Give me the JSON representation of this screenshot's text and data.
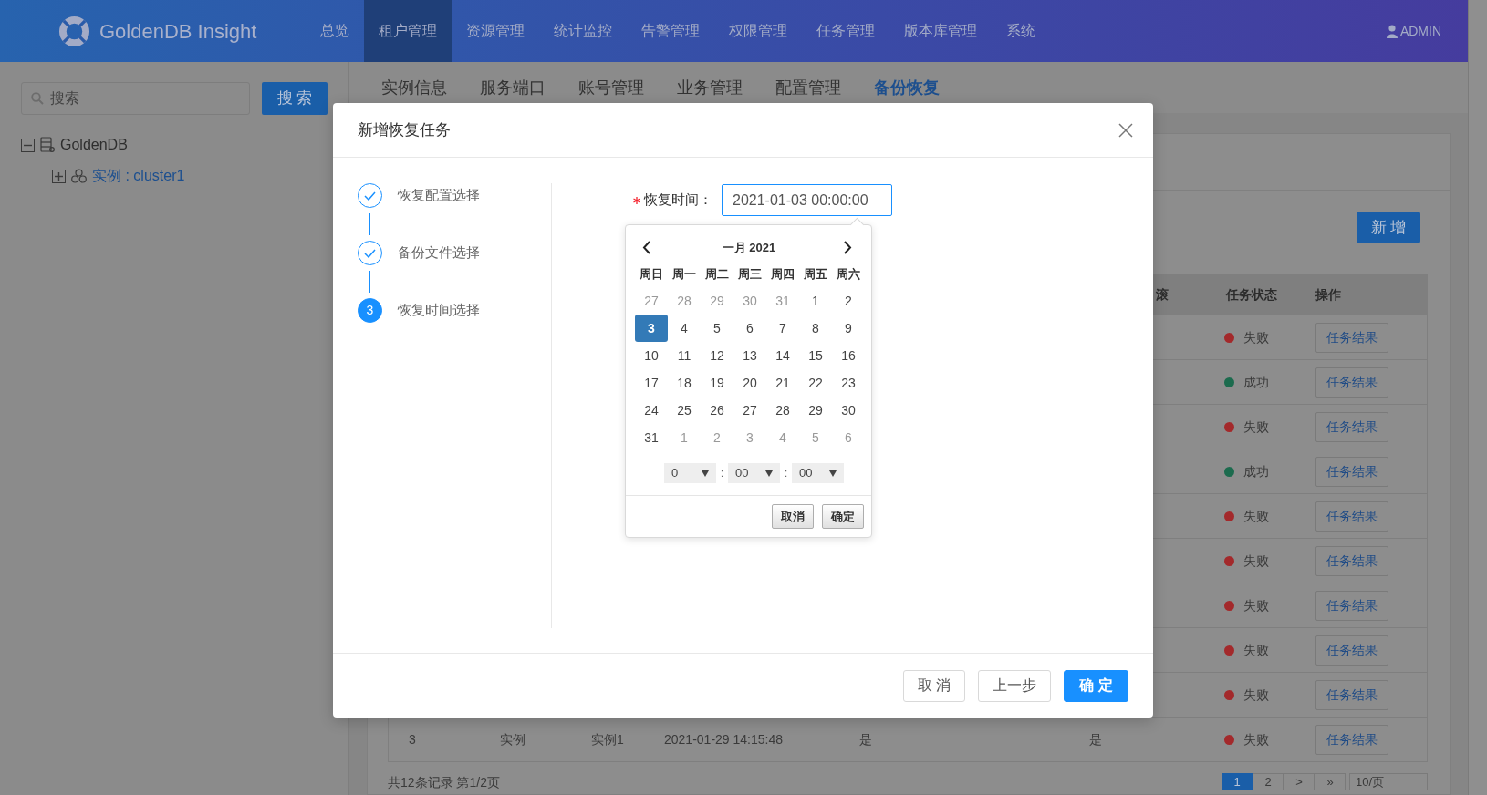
{
  "header": {
    "logo_text": "GoldenDB Insight",
    "nav": [
      {
        "label": "总览",
        "selected": false
      },
      {
        "label": "租户管理",
        "selected": true
      },
      {
        "label": "资源管理",
        "selected": false
      },
      {
        "label": "统计监控",
        "selected": false
      },
      {
        "label": "告警管理",
        "selected": false
      },
      {
        "label": "权限管理",
        "selected": false
      },
      {
        "label": "任务管理",
        "selected": false
      },
      {
        "label": "版本库管理",
        "selected": false
      },
      {
        "label": "系统",
        "selected": false
      }
    ],
    "user": "ADMIN"
  },
  "sidebar": {
    "search": {
      "placeholder": "搜索"
    },
    "search_button": "搜 索",
    "tree": [
      {
        "label": "GoldenDB",
        "expanded": true,
        "children": [
          {
            "label": "实例 : cluster1",
            "expanded": false
          }
        ]
      }
    ]
  },
  "tabs": [
    {
      "label": "实例信息",
      "selected": false
    },
    {
      "label": "服务端口",
      "selected": false
    },
    {
      "label": "账号管理",
      "selected": false
    },
    {
      "label": "业务管理",
      "selected": false
    },
    {
      "label": "配置管理",
      "selected": false
    },
    {
      "label": "备份恢复",
      "selected": true
    }
  ],
  "toolbar": {
    "add_button": "新 增"
  },
  "table": {
    "columns": [
      "滚",
      "任务状态",
      "操作"
    ],
    "rows": [
      {
        "status": "失败",
        "color": "#a3292b",
        "action": "任务结果"
      },
      {
        "status": "成功",
        "color": "#1c6b4e",
        "action": "任务结果"
      },
      {
        "status": "失败",
        "color": "#a3292b",
        "action": "任务结果"
      },
      {
        "status": "成功",
        "color": "#1c6b4e",
        "action": "任务结果"
      },
      {
        "status": "失败",
        "color": "#a3292b",
        "action": "任务结果"
      },
      {
        "status": "失败",
        "color": "#a3292b",
        "action": "任务结果"
      },
      {
        "status": "失败",
        "color": "#a3292b",
        "action": "任务结果"
      },
      {
        "status": "失败",
        "color": "#a3292b",
        "action": "任务结果"
      },
      {
        "status": "失败",
        "color": "#a3292b",
        "action": "任务结果"
      },
      {
        "cells": [
          "3",
          "实例",
          "实例1",
          "2021-01-29 14:15:48",
          "是",
          "是"
        ],
        "status": "失败",
        "color": "#a3292b",
        "action": "任务结果"
      }
    ]
  },
  "pagination": {
    "info": "共12条记录 第1/2页",
    "pages": [
      {
        "label": "1",
        "selected": true
      },
      {
        "label": "2",
        "selected": false
      }
    ],
    "next": ">",
    "last": "»",
    "page_size": "10/页"
  },
  "dialog": {
    "title": "新增恢复任务",
    "steps": [
      {
        "label": "恢复配置选择",
        "completed": true
      },
      {
        "label": "备份文件选择",
        "completed": true
      },
      {
        "label": "恢复时间选择",
        "completed": false,
        "number": "3"
      }
    ],
    "field": {
      "label": "恢复时间：",
      "required": true,
      "value": "2021-01-03 00:00:00"
    },
    "datepicker": {
      "month_title": "一月 2021",
      "weekdays": [
        "周日",
        "周一",
        "周二",
        "周三",
        "周四",
        "周五",
        "周六"
      ],
      "weeks": [
        [
          {
            "label": "27",
            "muted": true,
            "selected": false
          },
          {
            "label": "28",
            "muted": true,
            "selected": false
          },
          {
            "label": "29",
            "muted": true,
            "selected": false
          },
          {
            "label": "30",
            "muted": true,
            "selected": false
          },
          {
            "label": "31",
            "muted": true,
            "selected": false
          },
          {
            "label": "1",
            "muted": false,
            "selected": false
          },
          {
            "label": "2",
            "muted": false,
            "selected": false
          }
        ],
        [
          {
            "label": "3",
            "muted": false,
            "selected": true
          },
          {
            "label": "4",
            "muted": false,
            "selected": false
          },
          {
            "label": "5",
            "muted": false,
            "selected": false
          },
          {
            "label": "6",
            "muted": false,
            "selected": false
          },
          {
            "label": "7",
            "muted": false,
            "selected": false
          },
          {
            "label": "8",
            "muted": false,
            "selected": false
          },
          {
            "label": "9",
            "muted": false,
            "selected": false
          }
        ],
        [
          {
            "label": "10",
            "muted": false,
            "selected": false
          },
          {
            "label": "11",
            "muted": false,
            "selected": false
          },
          {
            "label": "12",
            "muted": false,
            "selected": false
          },
          {
            "label": "13",
            "muted": false,
            "selected": false
          },
          {
            "label": "14",
            "muted": false,
            "selected": false
          },
          {
            "label": "15",
            "muted": false,
            "selected": false
          },
          {
            "label": "16",
            "muted": false,
            "selected": false
          }
        ],
        [
          {
            "label": "17",
            "muted": false,
            "selected": false
          },
          {
            "label": "18",
            "muted": false,
            "selected": false
          },
          {
            "label": "19",
            "muted": false,
            "selected": false
          },
          {
            "label": "20",
            "muted": false,
            "selected": false
          },
          {
            "label": "21",
            "muted": false,
            "selected": false
          },
          {
            "label": "22",
            "muted": false,
            "selected": false
          },
          {
            "label": "23",
            "muted": false,
            "selected": false
          }
        ],
        [
          {
            "label": "24",
            "muted": false,
            "selected": false
          },
          {
            "label": "25",
            "muted": false,
            "selected": false
          },
          {
            "label": "26",
            "muted": false,
            "selected": false
          },
          {
            "label": "27",
            "muted": false,
            "selected": false
          },
          {
            "label": "28",
            "muted": false,
            "selected": false
          },
          {
            "label": "29",
            "muted": false,
            "selected": false
          },
          {
            "label": "30",
            "muted": false,
            "selected": false
          }
        ],
        [
          {
            "label": "31",
            "muted": false,
            "selected": false
          },
          {
            "label": "1",
            "muted": true,
            "selected": false
          },
          {
            "label": "2",
            "muted": true,
            "selected": false
          },
          {
            "label": "3",
            "muted": true,
            "selected": false
          },
          {
            "label": "4",
            "muted": true,
            "selected": false
          },
          {
            "label": "5",
            "muted": true,
            "selected": false
          },
          {
            "label": "6",
            "muted": true,
            "selected": false
          }
        ]
      ],
      "time": {
        "hour": "0",
        "minute": "00",
        "second": "00",
        "separators": [
          ":",
          ":"
        ]
      },
      "buttons": [
        "取消",
        "确定"
      ]
    },
    "buttons": [
      {
        "label": "取 消",
        "kind": "default"
      },
      {
        "label": "上一步",
        "kind": "default"
      },
      {
        "label": "确 定",
        "kind": "primary"
      }
    ]
  }
}
